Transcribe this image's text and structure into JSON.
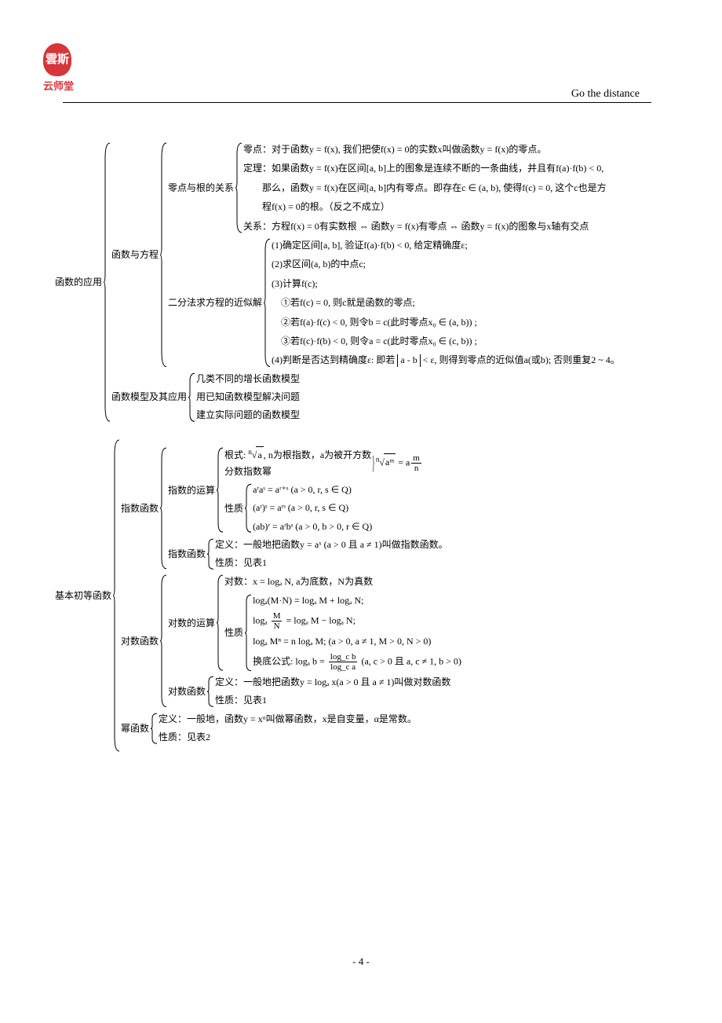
{
  "header": {
    "logo_char": "雲斯",
    "logo_text": "云师堂",
    "slogan": "Go the distance"
  },
  "tree1": {
    "root": "函数的应用",
    "b1": {
      "label": "函数与方程",
      "b1_1": {
        "label": "零点与根的关系",
        "lines": [
          "零点：对于函数y = f(x), 我们把使f(x) = 0的实数x叫做函数y = f(x)的零点。",
          "定理：如果函数y = f(x)在区间[a, b]上的图象是连续不断的一条曲线，并且有f(a)·f(b) < 0,",
          "　　那么，函数y = f(x)在区间[a, b]内有零点。即存在c ∈ (a, b), 使得f(c) = 0, 这个c也是方",
          "　　程f(x) = 0的根。（反之不成立）",
          "关系：方程f(x) = 0有实数根 ⇔ 函数y = f(x)有零点 ⇔ 函数y = f(x)的图象与x轴有交点"
        ]
      },
      "b1_2": {
        "label": "二分法求方程的近似解",
        "lines": [
          "(1)确定区间[a, b], 验证f(a)·f(b) < 0, 给定精确度ε;",
          "(2)求区间(a, b)的中点c;",
          "(3)计算f(c);",
          "　①若f(c) = 0, 则c就是函数的零点;",
          "　②若f(a)·f(c) < 0, 则令b = c(此时零点x₀ ∈ (a, b)) ;",
          "　③若f(c)·f(b) < 0, 则令a = c(此时零点x₀ ∈ (c, b)) ;"
        ],
        "line_abs_pre": "(4)判断是否达到精确度ε: 即若 ",
        "line_abs_mid": "a - b",
        "line_abs_post": " < ε, 则得到零点的近似值a(或b); 否则重复2 ~ 4。"
      }
    },
    "b2": {
      "label": "函数模型及其应用",
      "lines": [
        "几类不同的增长函数模型",
        "用已知函数模型解决问题",
        "建立实际问题的函数模型"
      ]
    }
  },
  "tree2": {
    "root": "基本初等函数",
    "exp": {
      "label": "指数函数",
      "calc": {
        "label": "指数的运算",
        "root_pre": "根式: ",
        "root_n": "n",
        "root_a": "a",
        "root_post": ", n为根指数，a为被开方数",
        "frac_label": "分数指数幂",
        "right_n": "n",
        "right_am": "aᵐ",
        "right_eq": " = a",
        "right_mn_num": "m",
        "right_mn_den": "n",
        "prop_label": "性质",
        "props": [
          "aʳaˢ = aʳ⁺ˢ (a > 0, r, s ∈ Q)",
          "(aʳ)ˢ = aʳˢ (a > 0, r, s ∈ Q)",
          "(ab)ʳ = aʳbˢ (a > 0, b > 0, r ∈ Q)"
        ]
      },
      "func": {
        "label": "指数函数",
        "def": "定义：一般地把函数y = aˣ (a > 0 且 a ≠ 1)叫做指数函数。",
        "prop": "性质：见表1"
      }
    },
    "log": {
      "label": "对数函数",
      "calc": {
        "label": "对数的运算",
        "def": "对数：x = logₐ N, a为底数，N为真数",
        "prop_label": "性质",
        "p1": "logₐ(M·N) = logₐ M + logₐ N;",
        "p2_pre": "logₐ ",
        "p2_num": "M",
        "p2_den": "N",
        "p2_post": " = logₐ M − logₐ N;",
        "p3": "logₐ Mⁿ = n logₐ M; (a > 0, a ≠ 1, M > 0, N > 0)",
        "p4_pre": "换底公式: logₐ b = ",
        "p4_num": "log_c b",
        "p4_den": "log_c a",
        "p4_post": " (a, c > 0 且 a, c ≠ 1, b > 0)"
      },
      "func": {
        "label": "对数函数",
        "def": "定义：一般地把函数y = logₐ x(a > 0 且 a ≠ 1)叫做对数函数",
        "prop": "性质：见表1"
      }
    },
    "pow": {
      "label": "幂函数",
      "def": "定义：一般地，函数y = xᵅ叫做幂函数，x是自变量，α是常数。",
      "prop": "性质：见表2"
    }
  },
  "pagenum": "- 4 -"
}
